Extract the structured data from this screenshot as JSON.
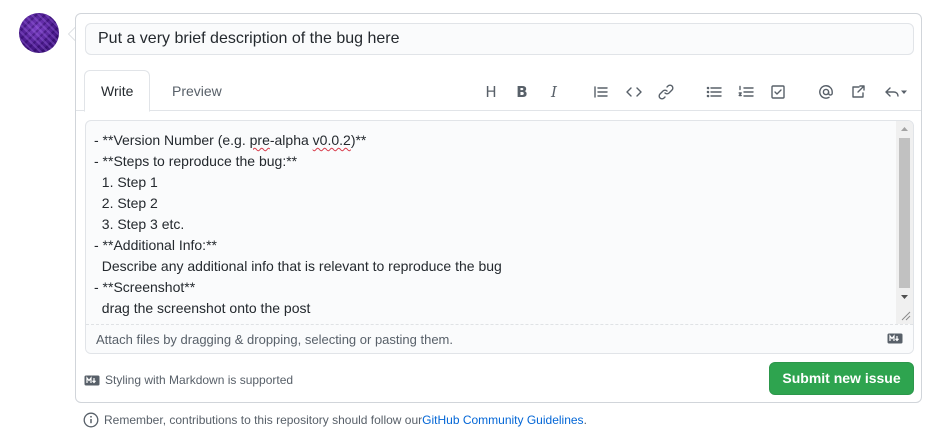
{
  "title_field": {
    "value": "Put a very brief description of the bug here"
  },
  "tabs": [
    {
      "label": "Write",
      "active": true
    },
    {
      "label": "Preview",
      "active": false
    }
  ],
  "toolbar": {
    "heading_label": "H",
    "bold_label": "B",
    "italic_label": "I",
    "icons": [
      "heading-icon",
      "bold-icon",
      "italic-icon",
      "quote-icon",
      "code-icon",
      "link-icon",
      "bulleted-list-icon",
      "numbered-list-icon",
      "task-list-icon",
      "mention-icon",
      "reference-icon",
      "reply-icon"
    ]
  },
  "body_text": {
    "lines": [
      {
        "prefix": "- **Version Number (e.g. ",
        "squiggle1": "pre",
        "mid": "-alpha ",
        "squiggle2": "v0.0.2",
        "suffix": ")**"
      },
      "- **Steps to reproduce the bug:**",
      "  1. Step 1",
      "  2. Step 2",
      "  3. Step 3 etc.",
      "- **Additional Info:**",
      "  Describe any additional info that is relevant to reproduce the bug",
      "- **Screenshot**",
      "  drag the screenshot onto the post"
    ]
  },
  "attach_text": "Attach files by dragging & dropping, selecting or pasting them.",
  "markdown_hint": "Styling with Markdown is supported",
  "submit_label": "Submit new issue",
  "footer": {
    "prefix": "Remember, contributions to this repository should follow our ",
    "link": "GitHub Community Guidelines",
    "suffix": "."
  },
  "colors": {
    "submit_bg": "#2ea44f",
    "link": "#0366d6",
    "border": "#d1d5da"
  }
}
